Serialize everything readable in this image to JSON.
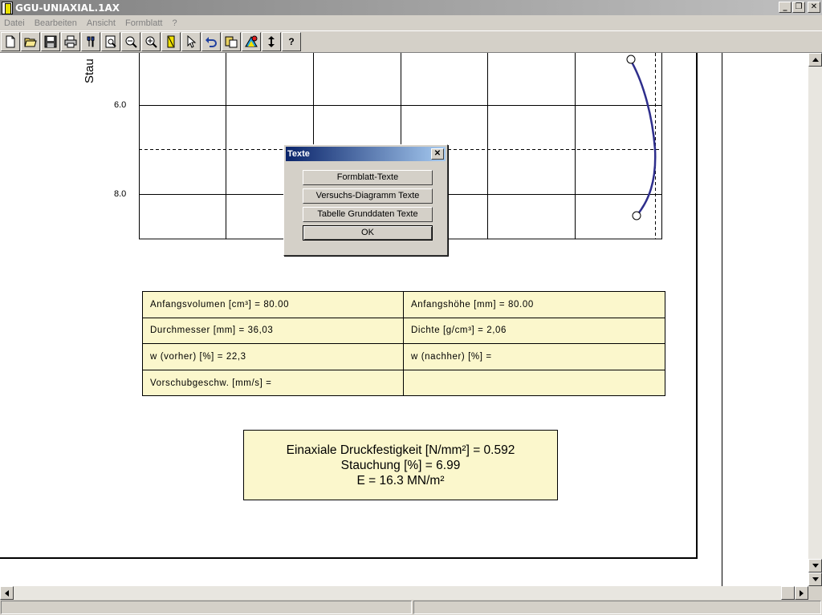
{
  "window": {
    "title": "GGU-UNIAXIAL.1AX"
  },
  "menu": {
    "items": [
      "Datei",
      "Bearbeiten",
      "Ansicht",
      "Formblatt",
      "?"
    ]
  },
  "toolbar": {
    "buttons": [
      "new-file",
      "open-folder",
      "save",
      "print",
      "tools",
      "zoom-page",
      "zoom-out",
      "zoom-in",
      "yellow-marker",
      "pointer",
      "undo",
      "copy-paste",
      "color-palette",
      "vertical-arrows",
      "help"
    ],
    "help_label": "?"
  },
  "chart": {
    "ylabel": "Stau",
    "ticks": [
      "6.0",
      "8.0"
    ]
  },
  "chart_data": {
    "type": "line",
    "ylabel": "Stau",
    "y_ticks": [
      6.0,
      8.0
    ],
    "series": [
      {
        "points": [
          {
            "x": 0.0,
            "y": 5.0
          },
          {
            "x": 0.12,
            "y": 5.6
          },
          {
            "x": 0.16,
            "y": 6.2
          },
          {
            "x": 0.18,
            "y": 6.99
          },
          {
            "x": 0.16,
            "y": 7.6
          },
          {
            "x": 0.12,
            "y": 8.2
          },
          {
            "x": 0.07,
            "y": 8.5
          }
        ]
      }
    ]
  },
  "dialog": {
    "title": "Texte",
    "buttons": [
      "Formblatt-Texte",
      "Versuchs-Diagramm Texte",
      "Tabelle Grunddaten Texte",
      "OK"
    ]
  },
  "table": {
    "rows": [
      [
        "Anfangsvolumen [cm³] =  80.00",
        "Anfangshöhe [mm] =  80.00"
      ],
      [
        "Durchmesser [mm] =  36,03",
        "Dichte [g/cm³] =  2,06"
      ],
      [
        "w (vorher) [%] =  22,3",
        "w (nachher) [%] ="
      ],
      [
        "Vorschubgeschw. [mm/s] =",
        ""
      ]
    ]
  },
  "results": {
    "line1": "Einaxiale Druckfestigkeit [N/mm²] = 0.592",
    "line2": "Stauchung [%] = 6.99",
    "line3": "E  = 16.3 MN/m²"
  },
  "colors": {
    "curve": "#2e2e8c",
    "table_bg": "#fbf7cc",
    "title_start": "#0a246a",
    "title_end": "#a6caf0"
  }
}
